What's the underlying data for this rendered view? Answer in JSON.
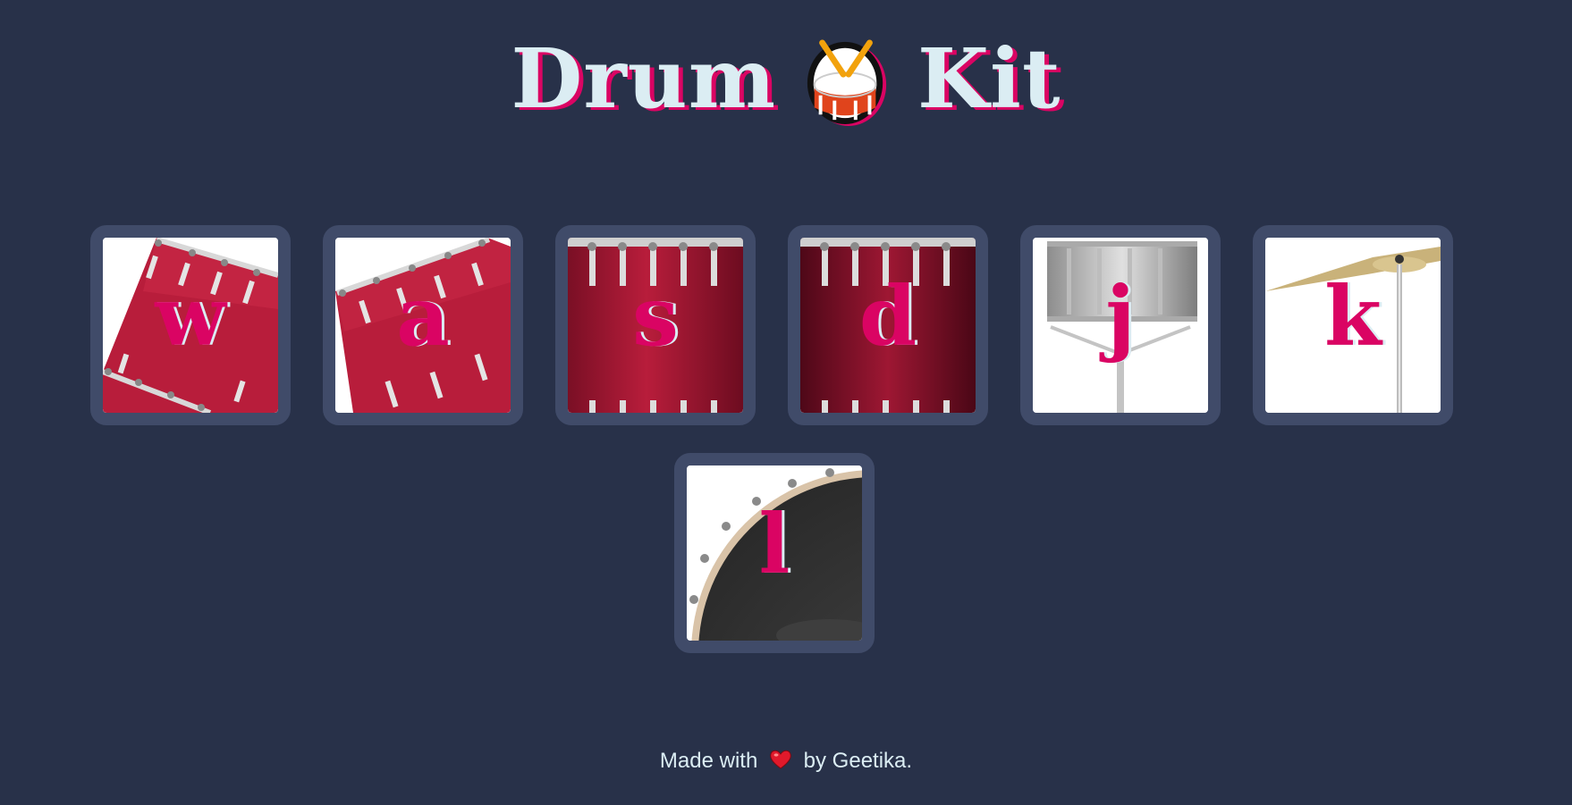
{
  "header": {
    "title_word_1": "Drum",
    "title_word_2": "Kit",
    "title_icon": "drum-icon"
  },
  "colors": {
    "background": "#283149",
    "tile_border": "#404b69",
    "accent_pink": "#da0463",
    "text_light": "#dbedf3"
  },
  "drums": [
    {
      "key": "w",
      "image": "tom-drum-tilted"
    },
    {
      "key": "a",
      "image": "tom-drum-tilted"
    },
    {
      "key": "s",
      "image": "red-drum-shell"
    },
    {
      "key": "d",
      "image": "dark-red-drum-shell"
    },
    {
      "key": "j",
      "image": "snare-drum-on-stand"
    },
    {
      "key": "k",
      "image": "crash-cymbal"
    },
    {
      "key": "l",
      "image": "bass-drum-head"
    }
  ],
  "footer": {
    "prefix": "Made with",
    "icon": "heart-icon",
    "suffix": "by Geetika."
  }
}
